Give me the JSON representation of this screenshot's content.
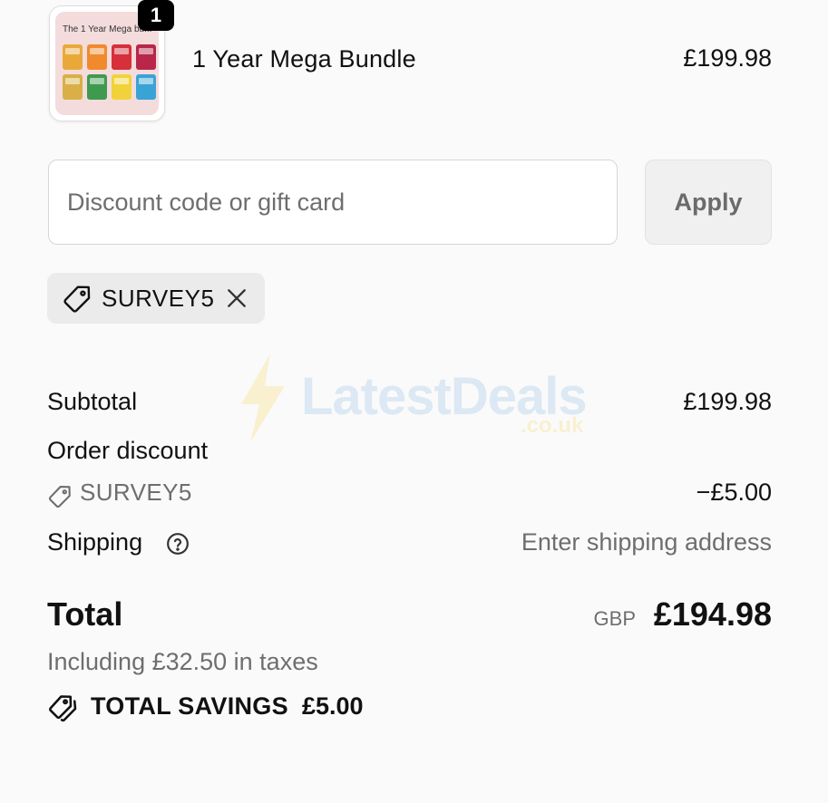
{
  "cart": {
    "item": {
      "quantity": "1",
      "name": "1 Year Mega Bundle",
      "price": "£199.98",
      "thumbnail_title": "The 1 Year Mega bu..."
    }
  },
  "discount": {
    "placeholder": "Discount code or gift card",
    "value": "",
    "apply_label": "Apply",
    "applied_code": "SURVEY5"
  },
  "watermark": {
    "text": "LatestDeals",
    "sub": ".co.uk"
  },
  "summary": {
    "subtotal_label": "Subtotal",
    "subtotal_value": "£199.98",
    "order_discount_label": "Order discount",
    "discount_code": "SURVEY5",
    "discount_amount": "−£5.00",
    "shipping_label": "Shipping",
    "shipping_value": "Enter shipping address",
    "total_label": "Total",
    "currency": "GBP",
    "total_value": "£194.98",
    "taxes_note": "Including £32.50 in taxes",
    "savings_label": "TOTAL SAVINGS",
    "savings_value": "£5.00"
  },
  "icons": {
    "tag": "tag-icon",
    "close": "close-icon",
    "help": "help-circle-icon",
    "savings": "double-tag-icon",
    "watermark": "lightning-bolt-icon"
  },
  "colors": {
    "background": "#fafafa",
    "chip_background": "#ebebeb",
    "muted_text": "#6e6e6e",
    "badge": "#000000"
  }
}
